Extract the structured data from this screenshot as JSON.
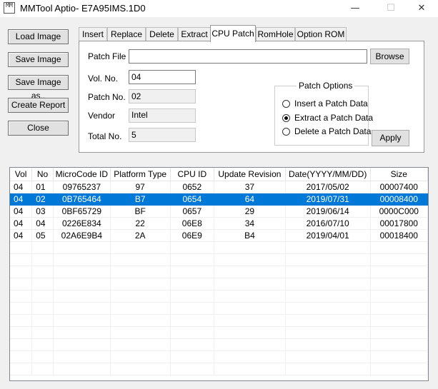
{
  "window": {
    "title": "MMTool Aptio- E7A95IMS.1D0",
    "icon_text": "MM",
    "controls": {
      "minimize": "—",
      "maximize": "☐",
      "close": "✕"
    }
  },
  "sidebar": {
    "load_image": "Load Image",
    "save_image": "Save Image",
    "save_image_as": "Save Image as..",
    "create_report": "Create Report",
    "close": "Close"
  },
  "tabs": [
    {
      "label": "Insert"
    },
    {
      "label": "Replace"
    },
    {
      "label": "Delete"
    },
    {
      "label": "Extract"
    },
    {
      "label": "CPU Patch"
    },
    {
      "label": "RomHole"
    },
    {
      "label": "Option ROM"
    }
  ],
  "active_tab": "CPU Patch",
  "cpu_patch": {
    "patch_file_label": "Patch File",
    "patch_file_value": "",
    "browse_label": "Browse",
    "vol_no_label": "Vol. No.",
    "vol_no_value": "04",
    "patch_no_label": "Patch No.",
    "patch_no_value": "02",
    "vendor_label": "Vendor",
    "vendor_value": "Intel",
    "total_no_label": "Total No.",
    "total_no_value": "5",
    "patch_options": {
      "title": "Patch Options",
      "options": [
        {
          "label": "Insert a Patch Data",
          "selected": false
        },
        {
          "label": "Extract a Patch Data",
          "selected": true
        },
        {
          "label": "Delete a Patch Data",
          "selected": false
        }
      ]
    },
    "apply_label": "Apply"
  },
  "table": {
    "columns": [
      "Vol",
      "No",
      "MicroCode ID",
      "Platform Type",
      "CPU ID",
      "Update Revision",
      "Date(YYYY/MM/DD)",
      "Size"
    ],
    "rows": [
      [
        "04",
        "01",
        "09765237",
        "97",
        "0652",
        "37",
        "2017/05/02",
        "00007400"
      ],
      [
        "04",
        "02",
        "0B765464",
        "B7",
        "0654",
        "64",
        "2019/07/31",
        "00008400"
      ],
      [
        "04",
        "03",
        "0BF65729",
        "BF",
        "0657",
        "29",
        "2019/06/14",
        "0000C000"
      ],
      [
        "04",
        "04",
        "0226E834",
        "22",
        "06E8",
        "34",
        "2016/07/10",
        "00017800"
      ],
      [
        "04",
        "05",
        "02A6E9B4",
        "2A",
        "06E9",
        "B4",
        "2019/04/01",
        "00018400"
      ]
    ],
    "selected_row_index": 1
  }
}
